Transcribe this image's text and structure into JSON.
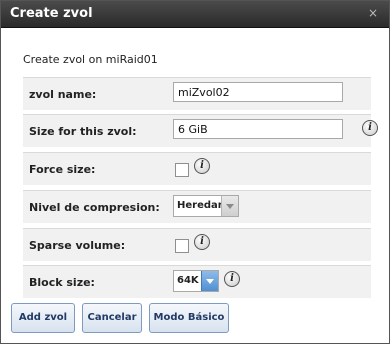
{
  "dialog": {
    "title": "Create zvol",
    "close_icon": "×",
    "subtitle": "Create zvol on miRaid01"
  },
  "form": {
    "zvol_name": {
      "label": "zvol name:",
      "value": "miZvol02"
    },
    "size": {
      "label": "Size for this zvol:",
      "value": "6 GiB"
    },
    "force_size": {
      "label": "Force size:",
      "checked": false
    },
    "compression": {
      "label": "Nivel de compresion:",
      "value": "Heredar"
    },
    "sparse": {
      "label": "Sparse volume:",
      "checked": false
    },
    "block_size": {
      "label": "Block size:",
      "value": "64K"
    }
  },
  "info_glyph": "i",
  "buttons": {
    "add": "Add zvol",
    "cancel": "Cancelar",
    "basic": "Modo Básico"
  },
  "colors": {
    "titlebar": "#3a3a3a",
    "row_bg": "#f1f1f1",
    "button_text": "#223a66",
    "active_arrow": "#4f8fd3"
  }
}
